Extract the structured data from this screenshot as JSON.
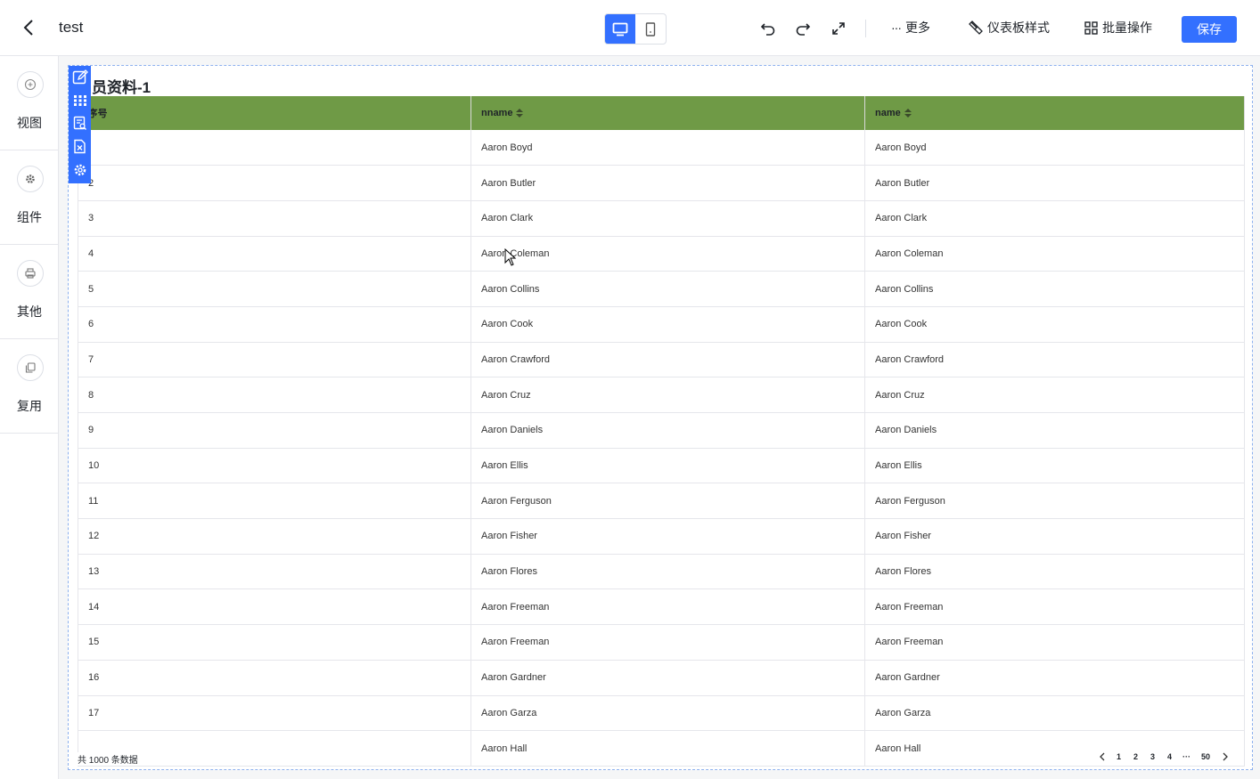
{
  "app": {
    "title": "test"
  },
  "toolbar": {
    "more_label": "更多",
    "style_label": "仪表板样式",
    "batch_label": "批量操作",
    "save_label": "保存"
  },
  "sidebar": {
    "items": [
      {
        "label": "视图",
        "icon": "plus-circle-icon"
      },
      {
        "label": "组件",
        "icon": "gear-icon"
      },
      {
        "label": "其他",
        "icon": "printer-icon"
      },
      {
        "label": "复用",
        "icon": "copy-icon"
      }
    ]
  },
  "widget": {
    "title": "员资料-1",
    "columns": [
      "序号",
      "nname",
      "name"
    ],
    "rows": [
      [
        "",
        "Aaron Boyd",
        "Aaron Boyd"
      ],
      [
        "2",
        "Aaron Butler",
        "Aaron Butler"
      ],
      [
        "3",
        "Aaron Clark",
        "Aaron Clark"
      ],
      [
        "4",
        "Aaron Coleman",
        "Aaron Coleman"
      ],
      [
        "5",
        "Aaron Collins",
        "Aaron Collins"
      ],
      [
        "6",
        "Aaron Cook",
        "Aaron Cook"
      ],
      [
        "7",
        "Aaron Crawford",
        "Aaron Crawford"
      ],
      [
        "8",
        "Aaron Cruz",
        "Aaron Cruz"
      ],
      [
        "9",
        "Aaron Daniels",
        "Aaron Daniels"
      ],
      [
        "10",
        "Aaron Ellis",
        "Aaron Ellis"
      ],
      [
        "11",
        "Aaron Ferguson",
        "Aaron Ferguson"
      ],
      [
        "12",
        "Aaron Fisher",
        "Aaron Fisher"
      ],
      [
        "13",
        "Aaron Flores",
        "Aaron Flores"
      ],
      [
        "14",
        "Aaron Freeman",
        "Aaron Freeman"
      ],
      [
        "15",
        "Aaron Freeman",
        "Aaron Freeman"
      ],
      [
        "16",
        "Aaron Gardner",
        "Aaron Gardner"
      ],
      [
        "17",
        "Aaron Garza",
        "Aaron Garza"
      ],
      [
        "",
        "Aaron Hall",
        "Aaron Hall"
      ]
    ],
    "total_text": "共 1000 条数据",
    "pagination": [
      "1",
      "2",
      "3",
      "4",
      "···",
      "50"
    ]
  },
  "colors": {
    "accent": "#3370ff",
    "header_green": "#6f9a46"
  }
}
